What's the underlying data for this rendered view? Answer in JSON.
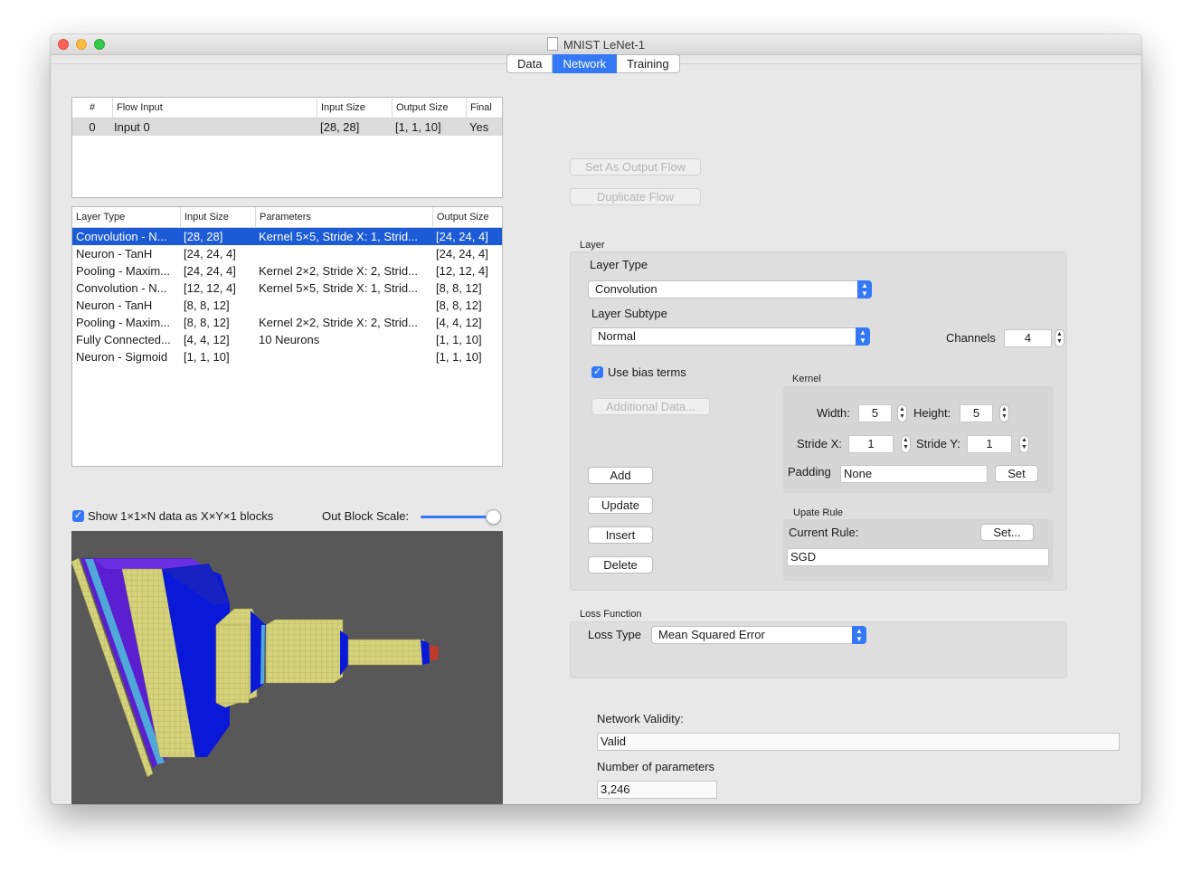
{
  "window": {
    "title": "MNIST LeNet-1"
  },
  "tabs": [
    {
      "label": "Data",
      "active": false
    },
    {
      "label": "Network",
      "active": true
    },
    {
      "label": "Training",
      "active": false
    }
  ],
  "flow_table": {
    "columns": [
      "#",
      "Flow Input",
      "Input Size",
      "Output Size",
      "Final"
    ],
    "rows": [
      {
        "num": "0",
        "flow_input": "Input 0",
        "input_size": "[28, 28]",
        "output_size": "[1, 1, 10]",
        "final": "Yes"
      }
    ]
  },
  "layer_table": {
    "columns": [
      "Layer Type",
      "Input Size",
      "Parameters",
      "Output Size"
    ],
    "rows": [
      {
        "layer_type": "Convolution - N...",
        "input_size": "[28, 28]",
        "parameters": "Kernel 5×5, Stride X: 1, Strid...",
        "output_size": "[24, 24, 4]"
      },
      {
        "layer_type": "Neuron - TanH",
        "input_size": "[24, 24, 4]",
        "parameters": "",
        "output_size": "[24, 24, 4]"
      },
      {
        "layer_type": "Pooling - Maxim...",
        "input_size": "[24, 24, 4]",
        "parameters": "Kernel 2×2, Stride X: 2, Strid...",
        "output_size": "[12, 12, 4]"
      },
      {
        "layer_type": "Convolution - N...",
        "input_size": "[12, 12, 4]",
        "parameters": "Kernel 5×5, Stride X: 1, Strid...",
        "output_size": "[8, 8, 12]"
      },
      {
        "layer_type": "Neuron - TanH",
        "input_size": "[8, 8, 12]",
        "parameters": "",
        "output_size": "[8, 8, 12]"
      },
      {
        "layer_type": "Pooling - Maxim...",
        "input_size": "[8, 8, 12]",
        "parameters": "Kernel 2×2, Stride X: 2, Strid...",
        "output_size": "[4, 4, 12]"
      },
      {
        "layer_type": "Fully Connected...",
        "input_size": "[4, 4, 12]",
        "parameters": "10 Neurons",
        "output_size": "[1, 1, 10]"
      },
      {
        "layer_type": "Neuron - Sigmoid",
        "input_size": "[1, 1, 10]",
        "parameters": "",
        "output_size": "[1, 1, 10]"
      }
    ]
  },
  "visual_options": {
    "show_blocks_label": "Show 1×1×N data as X×Y×1 blocks",
    "show_blocks_checked": true,
    "out_block_scale_label": "Out Block Scale:",
    "out_block_scale_value": 1.0
  },
  "flow_buttons": {
    "set_output": "Set As Output Flow",
    "duplicate": "Duplicate Flow"
  },
  "layer_group": {
    "title": "Layer",
    "layer_type_label": "Layer Type",
    "layer_type_value": "Convolution",
    "layer_subtype_label": "Layer Subtype",
    "layer_subtype_value": "Normal",
    "channels_label": "Channels",
    "channels_value": "4",
    "use_bias_label": "Use bias terms",
    "use_bias_checked": true,
    "additional_data": "Additional Data...",
    "add": "Add",
    "update": "Update",
    "insert": "Insert",
    "delete": "Delete"
  },
  "kernel_group": {
    "title": "Kernel",
    "width_label": "Width:",
    "width_value": "5",
    "height_label": "Height:",
    "height_value": "5",
    "stride_x_label": "Stride X:",
    "stride_x_value": "1",
    "stride_y_label": "Stride Y:",
    "stride_y_value": "1",
    "padding_label": "Padding",
    "padding_value": "None",
    "set_label": "Set"
  },
  "update_rule_group": {
    "title": "Upate Rule",
    "current_rule_label": "Current Rule:",
    "set_label": "Set...",
    "rule_value": "SGD"
  },
  "loss_group": {
    "title": "Loss Function",
    "loss_type_label": "Loss Type",
    "loss_type_value": "Mean Squared Error"
  },
  "validity": {
    "validity_label": "Network Validity:",
    "validity_value": "Valid",
    "params_label": "Number of parameters",
    "params_value": "3,246"
  },
  "colors": {
    "accent": "#3478f6",
    "selection": "#1c5bd6",
    "viz_background": "#585858",
    "block_yellow": "#d4d27a",
    "block_blue": "#0a18d8",
    "block_purple": "#5a1fd0"
  }
}
